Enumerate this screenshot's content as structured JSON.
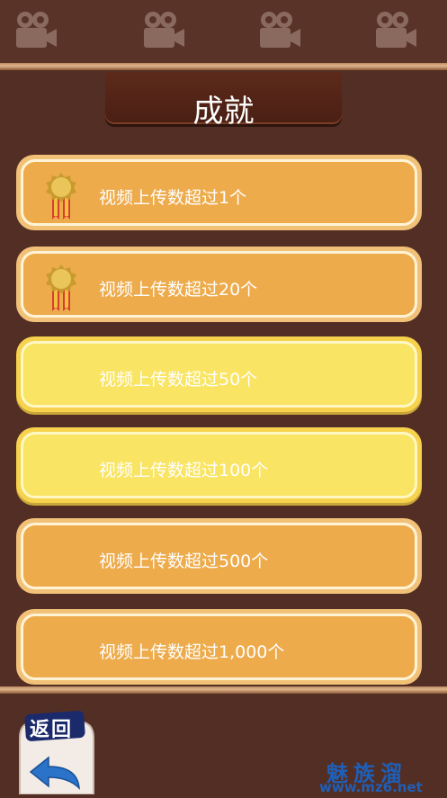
{
  "header": {
    "camera_icons": [
      "video-camera-icon",
      "video-camera-icon",
      "video-camera-icon",
      "video-camera-icon"
    ],
    "title": "成就"
  },
  "achievements": [
    {
      "label": "视频上传数超过1个",
      "unlocked": true,
      "style": "orange"
    },
    {
      "label": "视频上传数超过20个",
      "unlocked": true,
      "style": "orange"
    },
    {
      "label": "视频上传数超过50个",
      "unlocked": false,
      "style": "yellow"
    },
    {
      "label": "视频上传数超过100个",
      "unlocked": false,
      "style": "yellow"
    },
    {
      "label": "视频上传数超过500个",
      "unlocked": false,
      "style": "orange"
    },
    {
      "label": "视频上传数超过1,000个",
      "unlocked": false,
      "style": "orange"
    }
  ],
  "footer": {
    "back_label": "返回",
    "watermark_line1": "魅族溜",
    "watermark_line2": "www.mz6.net"
  },
  "colors": {
    "background": "#532e25",
    "card_orange": "#edab4c",
    "card_yellow": "#f9e463",
    "accent_blue": "#1e5fb8"
  }
}
